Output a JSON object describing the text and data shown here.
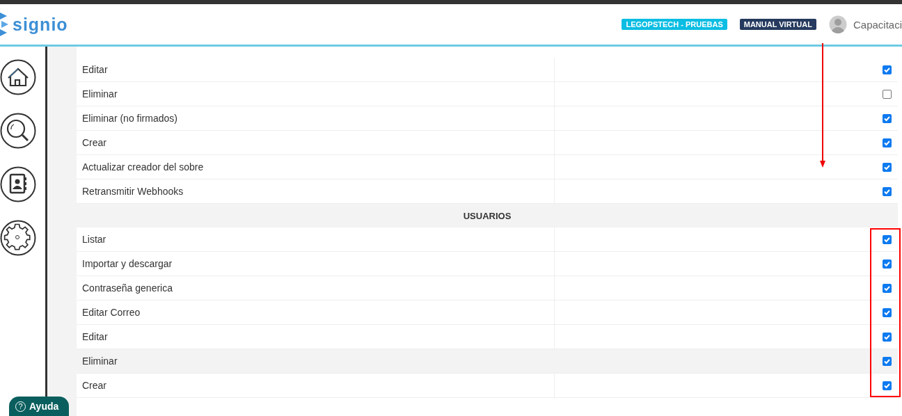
{
  "header": {
    "logo": "signio",
    "badges": [
      {
        "label": "LEGOPSTECH - PRUEBAS",
        "color": "#0abde3"
      },
      {
        "label": "MANUAL VIRTUAL",
        "color": "#253a5e"
      }
    ],
    "user": "Capacitaci"
  },
  "sidebar": {
    "items": [
      {
        "kind": "home"
      },
      {
        "kind": "search"
      },
      {
        "kind": "contacts"
      },
      {
        "kind": "settings"
      }
    ]
  },
  "rows": [
    {
      "kind": "permission",
      "label": "Editar",
      "checked": true,
      "hovered": false
    },
    {
      "kind": "permission",
      "label": "Eliminar",
      "checked": false,
      "hovered": false
    },
    {
      "kind": "permission",
      "label": "Eliminar (no firmados)",
      "checked": true,
      "hovered": false
    },
    {
      "kind": "permission",
      "label": "Crear",
      "checked": true,
      "hovered": false
    },
    {
      "kind": "permission",
      "label": "Actualizar creador del sobre",
      "checked": true,
      "hovered": false
    },
    {
      "kind": "permission",
      "label": "Retransmitir Webhooks",
      "checked": true,
      "hovered": false
    },
    {
      "kind": "section",
      "label": "USUARIOS"
    },
    {
      "kind": "permission",
      "label": "Listar",
      "checked": true,
      "hovered": false
    },
    {
      "kind": "permission",
      "label": "Importar y descargar",
      "checked": true,
      "hovered": false
    },
    {
      "kind": "permission",
      "label": "Contraseña generica",
      "checked": true,
      "hovered": false
    },
    {
      "kind": "permission",
      "label": "Editar Correo",
      "checked": true,
      "hovered": false
    },
    {
      "kind": "permission",
      "label": "Editar",
      "checked": true,
      "hovered": false
    },
    {
      "kind": "permission",
      "label": "Eliminar",
      "checked": true,
      "hovered": true
    },
    {
      "kind": "permission",
      "label": "Crear",
      "checked": true,
      "hovered": false
    }
  ],
  "annotations": [
    {
      "kind": "arrow"
    },
    {
      "kind": "rectangle"
    }
  ],
  "help_button": {
    "icon": "?",
    "label": "Ayuda"
  }
}
